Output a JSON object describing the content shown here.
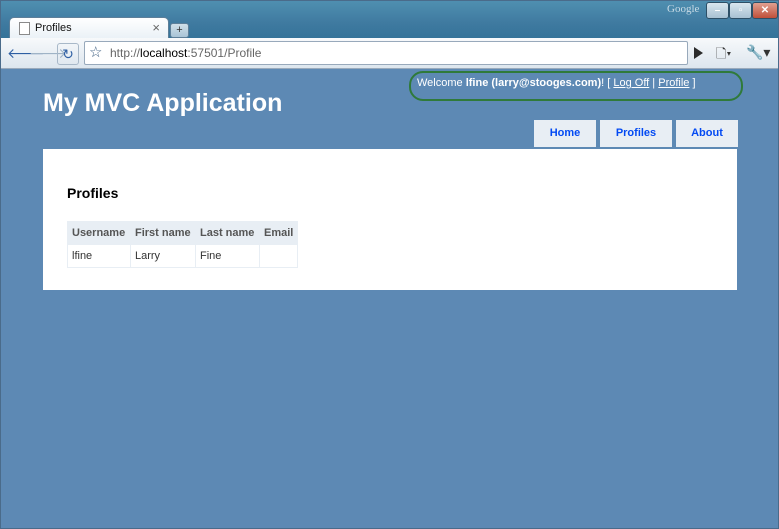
{
  "browser": {
    "tab_title": "Profiles",
    "tab_close": "×",
    "new_tab": "+",
    "brand": "Google",
    "url_scheme": "http://",
    "url_host": "localhost",
    "url_rest": ":57501/Profile",
    "icons": [
      "back-icon",
      "forward-icon",
      "reload-icon",
      "star-icon",
      "go-icon",
      "page-menu-icon",
      "wrench-menu-icon"
    ]
  },
  "header": {
    "welcome_prefix": "Welcome ",
    "user": "lfine (larry@stooges.com)",
    "welcome_suffix": "! [ ",
    "logoff": "Log Off",
    "separator": " | ",
    "profile": "Profile",
    "close_bracket": " ]",
    "app_title": "My MVC Application"
  },
  "menu": {
    "items": [
      "Home",
      "Profiles",
      "About"
    ]
  },
  "main": {
    "heading": "Profiles",
    "table": {
      "headers": [
        "Username",
        "First name",
        "Last name",
        "Email"
      ],
      "rows": [
        [
          "lfine",
          "Larry",
          "Fine",
          ""
        ]
      ]
    }
  }
}
